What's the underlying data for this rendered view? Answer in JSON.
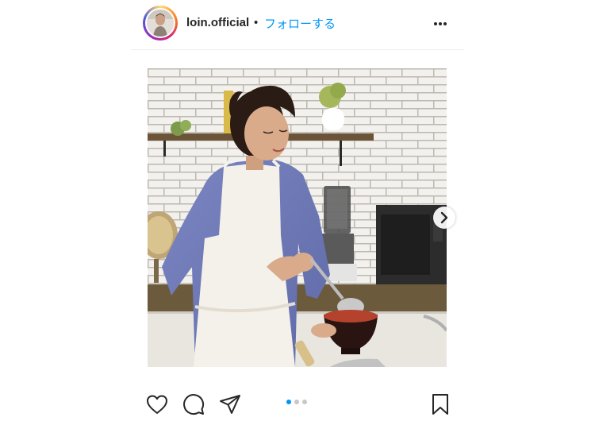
{
  "post": {
    "username": "loin.official",
    "separator": "•",
    "follow_label": "フォローする",
    "more_icon": "more-horizontal-icon",
    "accent_color": "#0095f6",
    "carousel": {
      "total_slides": 3,
      "active_slide": 1
    },
    "actions": {
      "like_icon": "heart-icon",
      "comment_icon": "comment-icon",
      "share_icon": "paper-plane-icon",
      "save_icon": "bookmark-icon"
    }
  }
}
